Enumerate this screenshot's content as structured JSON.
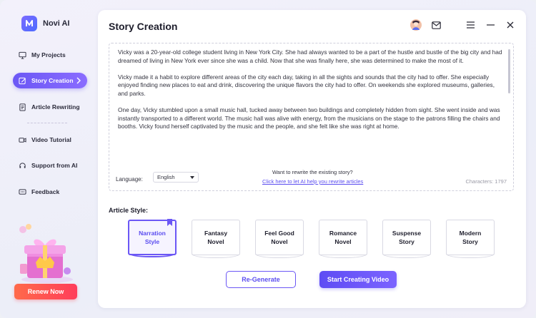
{
  "app": {
    "name": "Novi AI"
  },
  "sidebar": {
    "items": [
      {
        "label": "My Projects",
        "icon": "monitor-icon"
      },
      {
        "label": "Story Creation",
        "icon": "edit-icon",
        "active": true
      },
      {
        "label": "Article Rewriting",
        "icon": "document-icon"
      },
      {
        "label": "Video Tutorial",
        "icon": "video-icon"
      },
      {
        "label": "Support from AI",
        "icon": "headset-icon"
      },
      {
        "label": "Feedback",
        "icon": "chat-icon"
      }
    ],
    "renew_label": "Renew Now"
  },
  "header": {
    "title": "Story Creation",
    "icons": [
      "avatar",
      "mail-icon",
      "menu-icon",
      "minimize-icon",
      "close-icon"
    ]
  },
  "story": {
    "paragraphs": [
      "Vicky was a 20-year-old college student living in New York City. She had always wanted to be a part of the hustle and bustle of the big city and had dreamed of living in New York ever since she was a child. Now that she was finally here, she was determined to make the most of it.",
      "Vicky made it a habit to explore different areas of the city each day, taking in all the sights and sounds that the city had to offer. She especially enjoyed finding new places to eat and drink, discovering the unique flavors the city had to offer. On weekends she explored museums, galleries, and parks.",
      "One day, Vicky stumbled upon a small music hall, tucked away between two buildings and completely hidden from sight. She went inside and was instantly transported to a different world. The music hall was alive with energy, from the musicians on the stage to the patrons filling the chairs and booths. Vicky found herself captivated by the music and the people, and she felt like she was right at home."
    ],
    "language_label": "Language:",
    "language_value": "English",
    "rewrite_question": "Want to rewrite the existing story?",
    "rewrite_link": "Click here to let AI help you rewrite articles",
    "characters": "Characters: 1797"
  },
  "article_style": {
    "label": "Article Style:",
    "options": [
      {
        "line1": "Narration",
        "line2": "Style",
        "selected": true
      },
      {
        "line1": "Fantasy",
        "line2": "Novel"
      },
      {
        "line1": "Feel Good",
        "line2": "Novel"
      },
      {
        "line1": "Romance",
        "line2": "Novel"
      },
      {
        "line1": "Suspense",
        "line2": "Story"
      },
      {
        "line1": "Modern",
        "line2": "Story"
      }
    ]
  },
  "actions": {
    "regenerate_label": "Re-Generate",
    "start_label": "Start Creating Video"
  },
  "colors": {
    "accent": "#6b57f5",
    "renew": "#ff4a52",
    "link": "#5b4df0"
  }
}
